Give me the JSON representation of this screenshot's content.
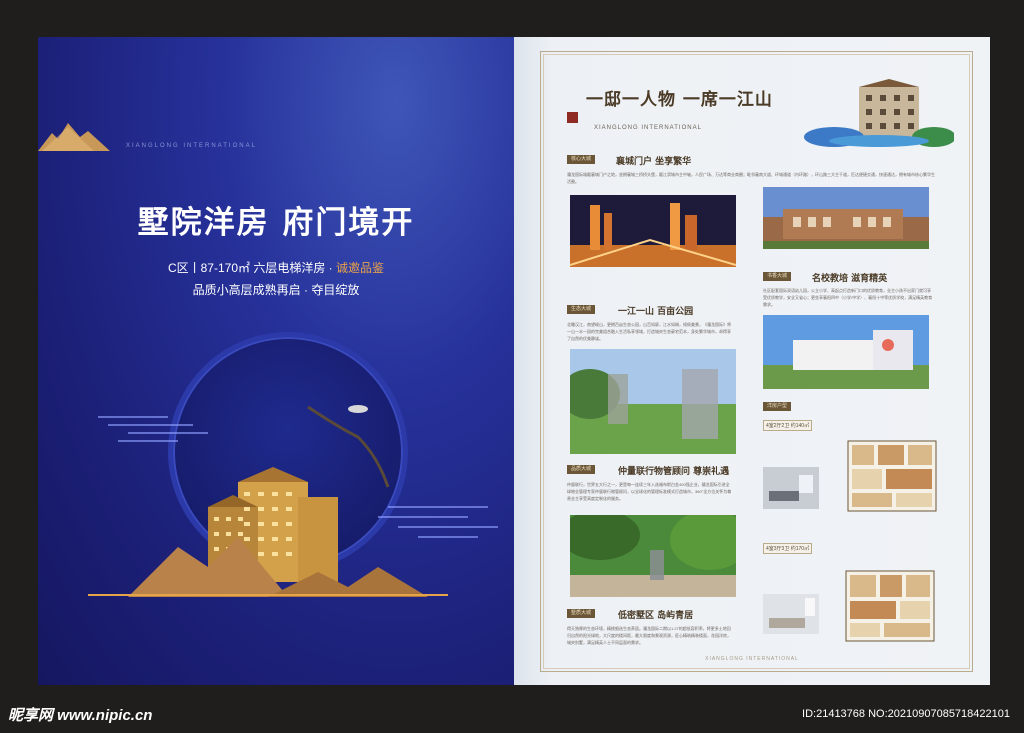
{
  "cover": {
    "en_subtitle": "XIANGLONG INTERNATIONAL",
    "title": "墅院洋房  府门境开",
    "line1_main": "C区丨87-170㎡ 六层电梯洋房 · ",
    "line1_highlight": "诚邀品鉴",
    "line2": "品质小高层成熟再启 · 夺目绽放"
  },
  "brochure": {
    "title": "一邸一人物 一席一江山",
    "en_title": "XIANGLONG INTERNATIONAL",
    "footer_en": "XIANGLONG INTERNATIONAL",
    "sections": [
      {
        "tag": "核心大城",
        "heading": "襄城门户 坐享繁华",
        "text": "骧龙国际雄踞襄城门户之地，坐拥襄城三桥桥头堡，踞江滨城市主中轴，人民广场、万达等商业商圈；毗邻襄南大道、环城通道（内环路），环山路三大主干道，匹达便捷交通，快速通达，拥有城市核心繁华生活圈。"
      },
      {
        "tag": "书香大城",
        "heading": "名校教培 滋育精英",
        "text": "社区配套国际双语幼儿园，公立小学、高起点打造新门口的优质教育，业主小孩不出家门就可享受优质教学，安全又省心；更坐享襄阳四中（小学/中学）、襄阳十中等优质学校，满足精英教育需求。"
      },
      {
        "tag": "生态大城",
        "heading": "一江一山 百亩公园",
        "text": "北瞰汉江，南望岘山，更拥百亩生态公园，山峦如屏，江水如绸，倾佩美景，《骧龙国际》将一山一水一园的完美组合融入生活私享领域，打造城央生态豪宅范本，身处繁华城市，却得享了自然的优美静谧。"
      },
      {
        "tag": "品质大城",
        "heading": "仲量联行物管顾问 尊崇礼遇",
        "text": "仲量联行，世界五大行之一，更是每一连续三年入选福布斯白金400强企业，骧龙国际引进全球物业管理专家仲量联行物管顾问，以全球化的管理标准模式打造城市，360°全方位关怀为尊贵业主享受高度定制化的服务。"
      },
      {
        "tag": "墅质大城",
        "heading": "低密墅区 岛屿青居",
        "text": "得天独厚的生态环境，精挑细选生态养居。骧龙国际二期以1.27的超低容积率，将更多土地回归自然的阳光绿地，大尺度的楼间距，最大限度和景观资源，匠心精筑精装楼面，花园洋房，城央别墅，满足精英人士不同层面的需求。"
      }
    ],
    "plans_tag": "洋房户型",
    "plans": [
      {
        "label": "4室2厅2卫",
        "area": "约140㎡"
      },
      {
        "label": "4室3厅3卫",
        "area": "约170㎡"
      }
    ]
  },
  "watermark": {
    "site": "昵享网 www.nipic.cn",
    "id": "ID:21413768 NO:20210907085718422101"
  }
}
